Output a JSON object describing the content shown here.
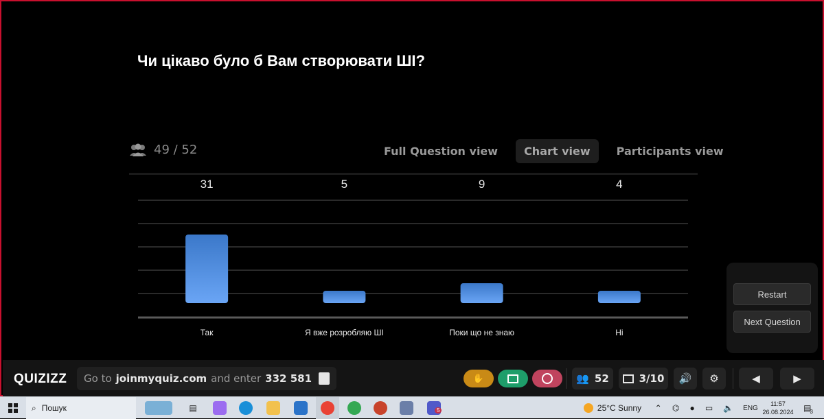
{
  "question": {
    "title": "Чи цікаво було б Вам створювати ШІ?"
  },
  "stats": {
    "responses": "49 / 52",
    "icon": "participants-icon"
  },
  "tabs": [
    {
      "label": "Full Question view",
      "active": false
    },
    {
      "label": "Chart view",
      "active": true
    },
    {
      "label": "Participants view",
      "active": false
    }
  ],
  "chart_data": {
    "type": "bar",
    "categories": [
      "Так",
      "Я вже розробляю ШІ",
      "Поки що не знаю",
      "Ні"
    ],
    "values": [
      31,
      5,
      9,
      4
    ],
    "colors": {
      "bar_top": "#3b78c9",
      "bar_bottom": "#6aa5f5",
      "grid": "#2a2a2a",
      "baseline": "#5a5a5a"
    },
    "grid": true
  },
  "panel": {
    "restart": "Restart",
    "next": "Next Question"
  },
  "bottom": {
    "logo": "QUIZIZZ",
    "join_prefix": "Go to",
    "join_site": "joinmyquiz.com",
    "join_middle": "and enter",
    "join_code": "332 581",
    "participants": "52",
    "slides": "3/10",
    "colors": {
      "hand": "#c98a16",
      "screen": "#1e9e6a",
      "wheel": "#c0445e"
    }
  },
  "taskbar": {
    "search": "Пошук",
    "weather": "25°C  Sunny",
    "lang": "ENG",
    "time": "11:57",
    "date": "26.08.2024",
    "notifications": "3",
    "teams_badge": "5"
  }
}
